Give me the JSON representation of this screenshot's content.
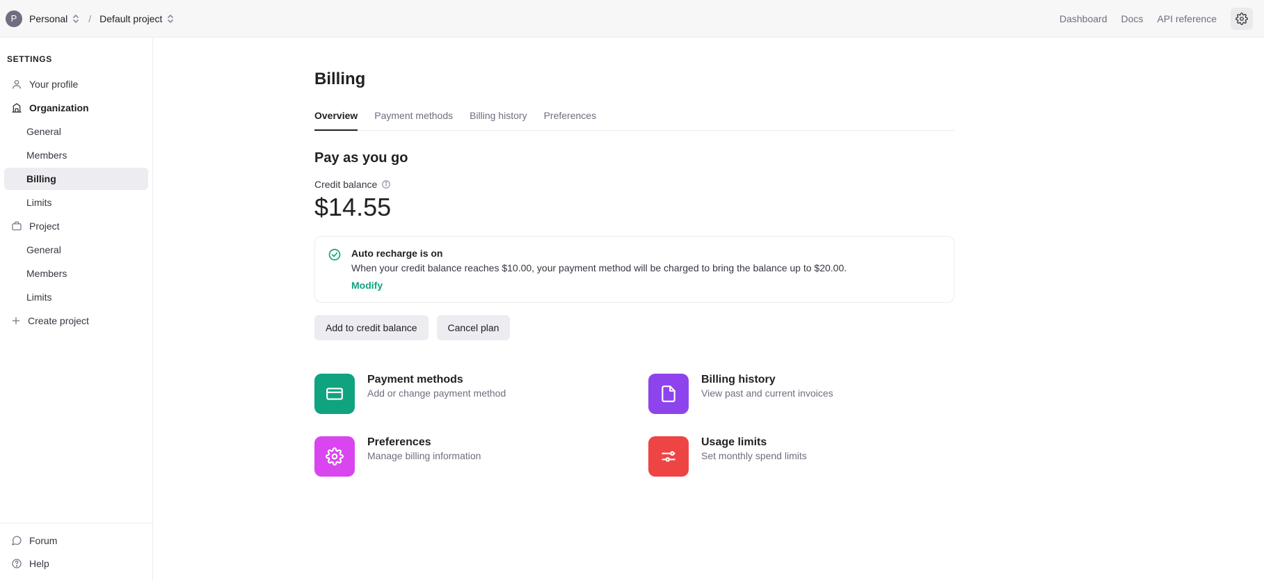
{
  "header": {
    "avatar_letter": "P",
    "breadcrumb1": "Personal",
    "breadcrumb_sep": "/",
    "breadcrumb2": "Default project",
    "links": {
      "dashboard": "Dashboard",
      "docs": "Docs",
      "api_reference": "API reference"
    }
  },
  "sidebar": {
    "heading": "SETTINGS",
    "your_profile": "Your profile",
    "organization": "Organization",
    "org_general": "General",
    "org_members": "Members",
    "org_billing": "Billing",
    "org_limits": "Limits",
    "project": "Project",
    "proj_general": "General",
    "proj_members": "Members",
    "proj_limits": "Limits",
    "create_project": "Create project",
    "footer_forum": "Forum",
    "footer_help": "Help"
  },
  "billing": {
    "page_title": "Billing",
    "tabs": {
      "overview": "Overview",
      "payment_methods": "Payment methods",
      "billing_history": "Billing history",
      "preferences": "Preferences"
    },
    "section_title": "Pay as you go",
    "balance_label": "Credit balance",
    "balance_amount": "$14.55",
    "notice": {
      "title": "Auto recharge is on",
      "desc": "When your credit balance reaches $10.00, your payment method will be charged to bring the balance up to $20.00.",
      "action": "Modify"
    },
    "btn_add": "Add to credit balance",
    "btn_cancel": "Cancel plan",
    "cards": {
      "pm_title": "Payment methods",
      "pm_desc": "Add or change payment method",
      "bh_title": "Billing history",
      "bh_desc": "View past and current invoices",
      "pref_title": "Preferences",
      "pref_desc": "Manage billing information",
      "ul_title": "Usage limits",
      "ul_desc": "Set monthly spend limits"
    }
  }
}
